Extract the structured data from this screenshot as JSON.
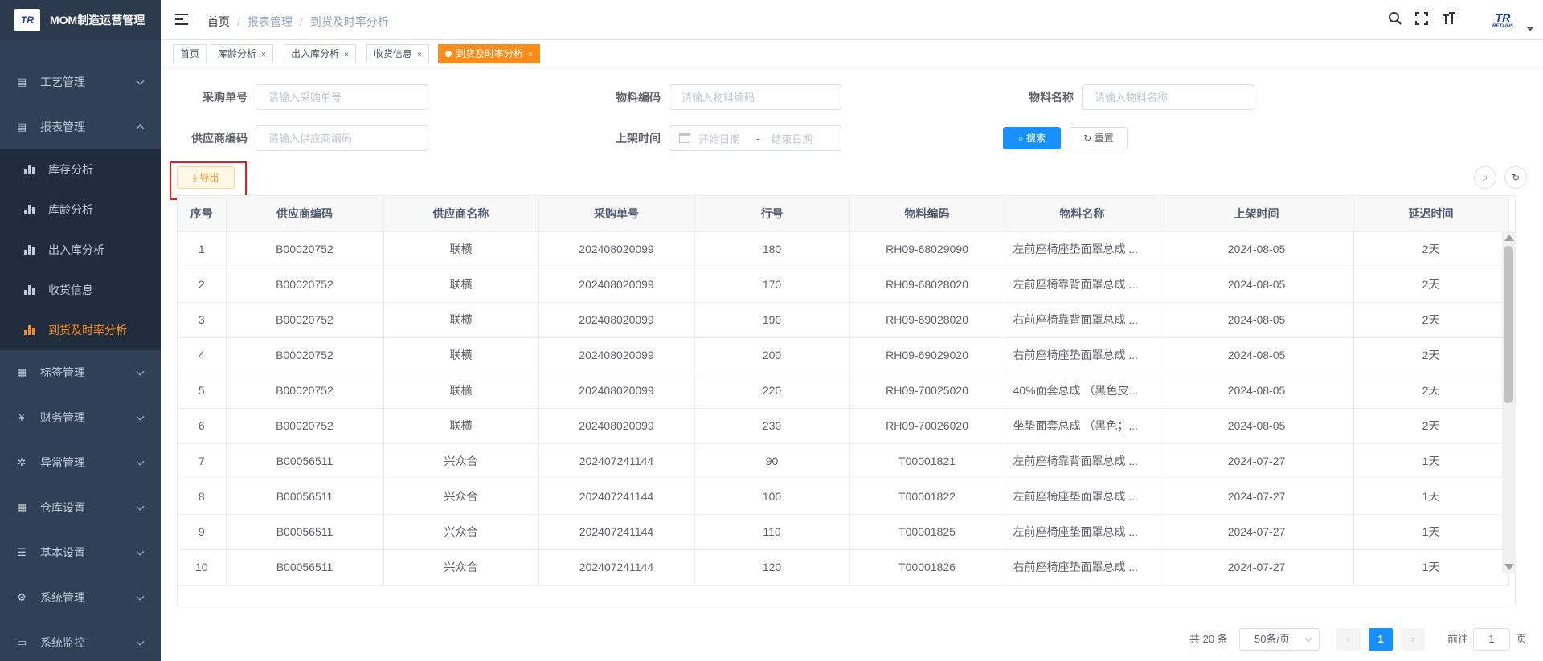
{
  "app": {
    "logo_text": "TR",
    "title": "MOM制造运营管理"
  },
  "sidebar": {
    "items": [
      {
        "label": "工艺管理",
        "icon": "process-icon"
      },
      {
        "label": "报表管理",
        "icon": "report-icon"
      },
      {
        "label": "标签管理",
        "icon": "tag-icon"
      },
      {
        "label": "财务管理",
        "icon": "yen-icon"
      },
      {
        "label": "异常管理",
        "icon": "bug-icon"
      },
      {
        "label": "仓库设置",
        "icon": "warehouse-icon"
      },
      {
        "label": "基本设置",
        "icon": "settings-sliders-icon"
      },
      {
        "label": "系统管理",
        "icon": "gear-icon"
      },
      {
        "label": "系统监控",
        "icon": "monitor-icon"
      }
    ],
    "sub_items": [
      {
        "label": "库存分析"
      },
      {
        "label": "库龄分析"
      },
      {
        "label": "出入库分析"
      },
      {
        "label": "收货信息"
      },
      {
        "label": "到货及时率分析"
      }
    ]
  },
  "header": {
    "breadcrumb": [
      "首页",
      "报表管理",
      "到货及时率分析"
    ],
    "separator": "/",
    "avatar_text": "TR",
    "avatar_sub": "RETAINS"
  },
  "tags": [
    {
      "label": "首页"
    },
    {
      "label": "库龄分析"
    },
    {
      "label": "出入库分析"
    },
    {
      "label": "收货信息"
    },
    {
      "label": "到货及时率分析"
    }
  ],
  "tag_close": "×",
  "form": {
    "purchase_no_label": "采购单号",
    "purchase_no_placeholder": "请输入采购单号",
    "material_code_label": "物料编码",
    "material_code_placeholder": "请输入物料编码",
    "material_name_label": "物料名称",
    "material_name_placeholder": "请输入物料名称",
    "supplier_code_label": "供应商编码",
    "supplier_code_placeholder": "请输入供应商编码",
    "shelf_time_label": "上架时间",
    "start_date_placeholder": "开始日期",
    "range_sep": "-",
    "end_date_placeholder": "结束日期",
    "search_label": "搜索",
    "reset_label": "重置"
  },
  "toolbar": {
    "export_label": "导出",
    "highlight_color": "#e02020"
  },
  "table": {
    "columns": [
      "序号",
      "供应商编码",
      "供应商名称",
      "采购单号",
      "行号",
      "物料编码",
      "物料名称",
      "上架时间",
      "延迟时间"
    ],
    "rows": [
      [
        "1",
        "B00020752",
        "联横",
        "202408020099",
        "180",
        "RH09-68029090",
        "左前座椅座垫面罩总成 ...",
        "2024-08-05",
        "2天"
      ],
      [
        "2",
        "B00020752",
        "联横",
        "202408020099",
        "170",
        "RH09-68028020",
        "左前座椅靠背面罩总成 ...",
        "2024-08-05",
        "2天"
      ],
      [
        "3",
        "B00020752",
        "联横",
        "202408020099",
        "190",
        "RH09-69028020",
        "右前座椅靠背面罩总成 ...",
        "2024-08-05",
        "2天"
      ],
      [
        "4",
        "B00020752",
        "联横",
        "202408020099",
        "200",
        "RH09-69029020",
        "右前座椅座垫面罩总成 ...",
        "2024-08-05",
        "2天"
      ],
      [
        "5",
        "B00020752",
        "联横",
        "202408020099",
        "220",
        "RH09-70025020",
        "40%面套总成 （黑色皮...",
        "2024-08-05",
        "2天"
      ],
      [
        "6",
        "B00020752",
        "联横",
        "202408020099",
        "230",
        "RH09-70026020",
        "坐垫面套总成 （黑色；...",
        "2024-08-05",
        "2天"
      ],
      [
        "7",
        "B00056511",
        "兴众合",
        "202407241144",
        "90",
        "T00001821",
        "左前座椅靠背面罩总成 ...",
        "2024-07-27",
        "1天"
      ],
      [
        "8",
        "B00056511",
        "兴众合",
        "202407241144",
        "100",
        "T00001822",
        "左前座椅座垫面罩总成 ...",
        "2024-07-27",
        "1天"
      ],
      [
        "9",
        "B00056511",
        "兴众合",
        "202407241144",
        "110",
        "T00001825",
        "左前座椅座垫面罩总成 ...",
        "2024-07-27",
        "1天"
      ],
      [
        "10",
        "B00056511",
        "兴众合",
        "202407241144",
        "120",
        "T00001826",
        "右前座椅座垫面罩总成 ...",
        "2024-07-27",
        "1天"
      ]
    ]
  },
  "pagination": {
    "total_text": "共 20 条",
    "page_size": "50条/页",
    "prev": "‹",
    "next": "›",
    "current_page": "1",
    "goto_label": "前往",
    "goto_value": "1",
    "page_unit": "页"
  },
  "colors": {
    "accent": "#ff8c1a",
    "primary": "#1890ff",
    "sidebar_bg": "#304156"
  }
}
